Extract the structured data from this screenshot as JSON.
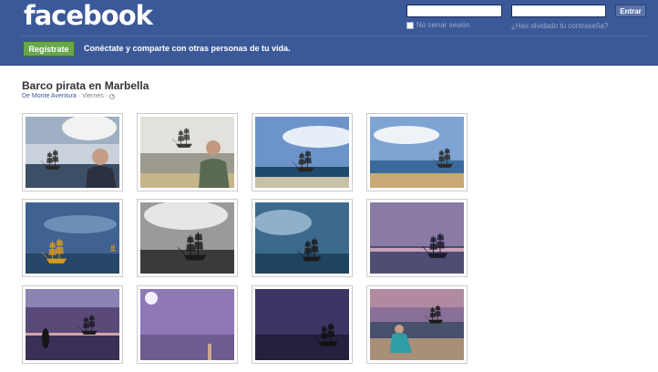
{
  "header": {
    "logo": "facebook",
    "remember_label": "No cerrar sesión",
    "forgot_label": "¿Has olvidado tu contraseña?",
    "login_button": "Entrar",
    "signup_button": "Regístrate",
    "tagline": "Conéctate y comparte con otras personas de tu vida."
  },
  "album": {
    "title": "Barco pirata en Marbella",
    "author": "De Monte Aventura",
    "separator": "·",
    "day": "Viernes",
    "separator2": "·"
  },
  "colors": {
    "facebook_blue": "#3b5998",
    "signup_green": "#69a74e"
  },
  "photos": [
    {
      "scene": "cloudy-man",
      "sky": "#b7c3d0"
    },
    {
      "scene": "sunset-man",
      "sky": "#d3d6d8"
    },
    {
      "scene": "ship-sea",
      "sky": "#6c94c8"
    },
    {
      "scene": "ship-beach",
      "sky": "#7ea4d4"
    },
    {
      "scene": "ship-gold",
      "sky": "#3f6290"
    },
    {
      "scene": "ship-bw",
      "sky": "#8a8a8a"
    },
    {
      "scene": "ship-teal",
      "sky": "#3d6a8c"
    },
    {
      "scene": "ship-purple",
      "sky": "#8a7aa6"
    },
    {
      "scene": "dusk-silhouette",
      "sky": "#5a4a7a"
    },
    {
      "scene": "purple-moon",
      "sky": "#8e78b6"
    },
    {
      "scene": "dark-ship",
      "sky": "#3c3664"
    },
    {
      "scene": "man-sitting",
      "sky": "#8a7098"
    }
  ]
}
